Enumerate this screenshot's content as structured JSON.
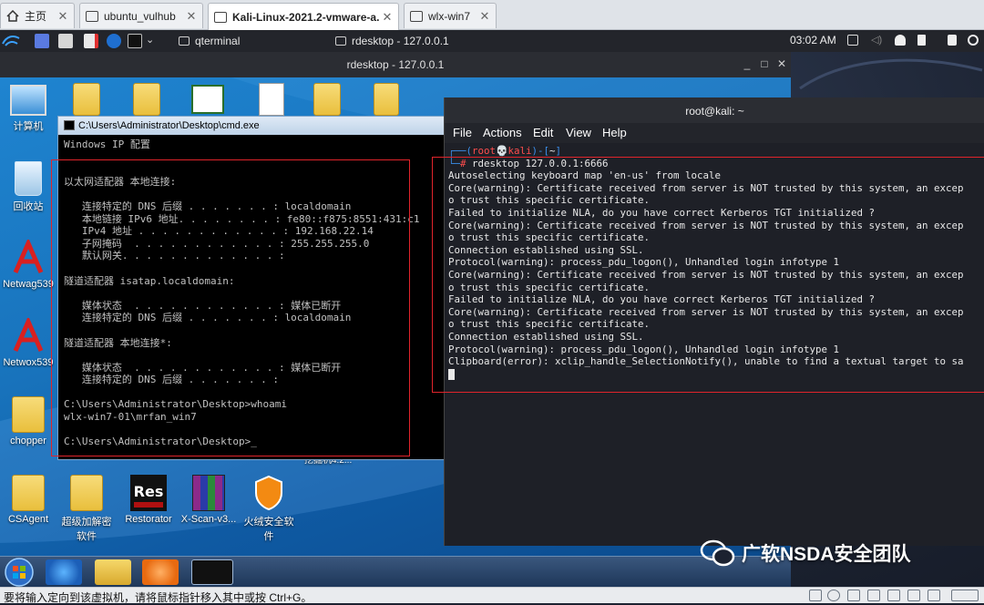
{
  "vm_tabs": [
    {
      "label": "主页",
      "icon": "home-icon",
      "active": false
    },
    {
      "label": "ubuntu_vulhub",
      "icon": "vm-icon",
      "active": false
    },
    {
      "label": "Kali-Linux-2021.2-vmware-a...",
      "icon": "vm-icon",
      "active": true
    },
    {
      "label": "wlx-win7",
      "icon": "vm-icon",
      "active": false
    }
  ],
  "kali_panel": {
    "task1": "qterminal",
    "task2": "rdesktop - 127.0.0.1",
    "clock": "03:02 AM"
  },
  "rdesktop": {
    "title": "rdesktop - 127.0.0.1"
  },
  "desktop_icons": [
    {
      "label": "计算机",
      "icon": "computer-icon"
    },
    {
      "label": "回收站",
      "icon": "recycle-bin-icon"
    },
    {
      "label": "Netwag539",
      "icon": "netwag-icon"
    },
    {
      "label": "Netwox539",
      "icon": "netwox-icon"
    },
    {
      "label": "chopper",
      "icon": "folder-icon"
    },
    {
      "label": "CSAgent",
      "icon": "folder-icon"
    },
    {
      "label": "超级加解密软件",
      "icon": "folder-icon"
    },
    {
      "label": "Restorator",
      "icon": "restorator-icon"
    },
    {
      "label": "X-Scan-v3...",
      "icon": "winrar-icon"
    },
    {
      "label": "火绒安全软件",
      "icon": "huorong-icon"
    }
  ],
  "desktop_hidden_label": "挖掘机4.2...",
  "cmd": {
    "title": "C:\\Users\\Administrator\\Desktop\\cmd.exe",
    "lines": [
      "Windows IP 配置",
      "",
      "",
      "以太网适配器 本地连接:",
      "",
      "   连接特定的 DNS 后缀 . . . . . . . : localdomain",
      "   本地链接 IPv6 地址. . . . . . . . : fe80::f875:8551:431:c1",
      "   IPv4 地址 . . . . . . . . . . . . : 192.168.22.14",
      "   子网掩码  . . . . . . . . . . . . : 255.255.255.0",
      "   默认网关. . . . . . . . . . . . . :",
      "",
      "隧道适配器 isatap.localdomain:",
      "",
      "   媒体状态  . . . . . . . . . . . . : 媒体已断开",
      "   连接特定的 DNS 后缀 . . . . . . . : localdomain",
      "",
      "隧道适配器 本地连接*:",
      "",
      "   媒体状态  . . . . . . . . . . . . : 媒体已断开",
      "   连接特定的 DNS 后缀 . . . . . . . :",
      "",
      "C:\\Users\\Administrator\\Desktop>whoami",
      "wlx-win7-01\\mrfan_win7",
      "",
      "C:\\Users\\Administrator\\Desktop>_"
    ]
  },
  "terminal": {
    "title": "root@kali: ~",
    "menu": [
      "File",
      "Actions",
      "Edit",
      "View",
      "Help"
    ],
    "prompt_line1_prefix": "┌──(",
    "prompt_user": "root💀kali",
    "prompt_line1_mid": ")-[",
    "prompt_dir": "~",
    "prompt_line1_suffix": "]",
    "prompt_line2_prefix": "└─",
    "prompt_symbol": "# ",
    "command": "rdesktop 127.0.0.1:6666",
    "lines": [
      "Autoselecting keyboard map 'en-us' from locale",
      "Core(warning): Certificate received from server is NOT trusted by this system, an excep",
      "o trust this specific certificate.",
      "Failed to initialize NLA, do you have correct Kerberos TGT initialized ?",
      "Core(warning): Certificate received from server is NOT trusted by this system, an excep",
      "o trust this specific certificate.",
      "Connection established using SSL.",
      "Protocol(warning): process_pdu_logon(), Unhandled login infotype 1",
      "Core(warning): Certificate received from server is NOT trusted by this system, an excep",
      "o trust this specific certificate.",
      "Failed to initialize NLA, do you have correct Kerberos TGT initialized ?",
      "Core(warning): Certificate received from server is NOT trusted by this system, an excep",
      "o trust this specific certificate.",
      "Connection established using SSL.",
      "Protocol(warning): process_pdu_logon(), Unhandled login infotype 1",
      "Clipboard(error): xclip_handle_SelectionNotify(), unable to find a textual target to sa"
    ]
  },
  "watermark": "广软NSDA安全团队",
  "status_bar": {
    "text": "要将输入定向到该虚拟机，请将鼠标指针移入其中或按 Ctrl+G。"
  },
  "colors": {
    "highlight": "#e0242b",
    "kali_prompt_blue": "#3b8eea",
    "kali_prompt_red": "#ff4d4d"
  }
}
